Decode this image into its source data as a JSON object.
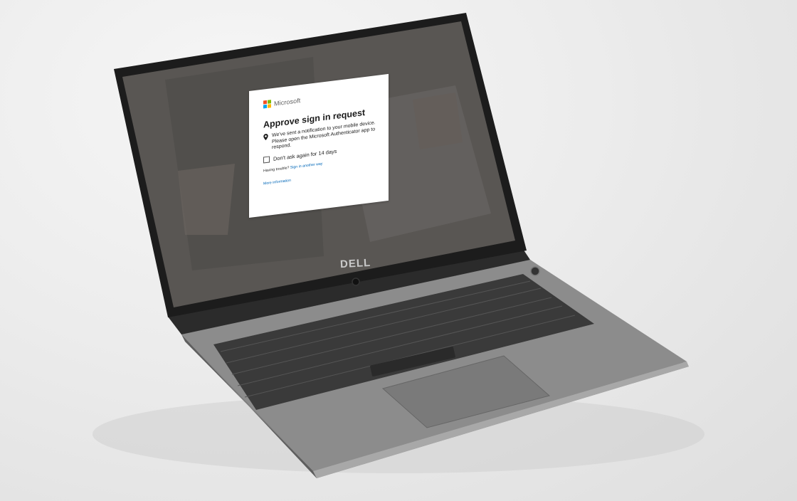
{
  "dialog": {
    "brand": "Microsoft",
    "title": "Approve sign in request",
    "notice_line1": "We've sent a notification to your mobile device.",
    "notice_line2": "Please open the Microsoft Authenticator app to",
    "notice_line3": "respond.",
    "checkbox_label": "Don't ask again for 14 days",
    "trouble_text": "Having trouble?",
    "trouble_link": "Sign in another way",
    "more_info": "More information"
  },
  "laptop": {
    "brand": "DELL"
  },
  "colors": {
    "ms_red": "#f25022",
    "ms_green": "#7fba00",
    "ms_blue": "#00a4ef",
    "ms_yellow": "#ffb900",
    "link": "#0067b8"
  }
}
